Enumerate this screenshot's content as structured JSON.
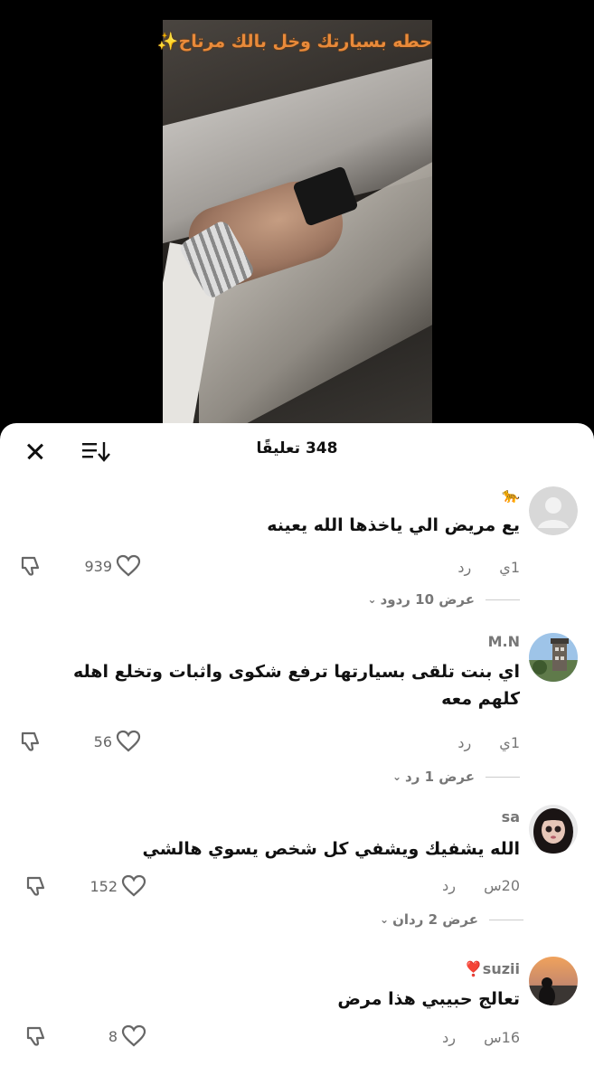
{
  "video": {
    "caption": "حطه بسيارتك وخل بالك مرتاح✨"
  },
  "sheet": {
    "title": "348 تعليقًا"
  },
  "comments": [
    {
      "username": "🐆",
      "text": "يع مريض الي ياخذها الله يعينه",
      "time": "1ي",
      "reply_label": "رد",
      "likes": "939",
      "view_replies": "عرض 10 ردود",
      "avatar": "default-avatar"
    },
    {
      "username": "M.N",
      "text": "اي بنت تلقى بسيارتها ترفع شكوى واثبات وتخلع اهله كلهم معه",
      "time": "1ي",
      "reply_label": "رد",
      "likes": "56",
      "view_replies": "عرض 1 رد",
      "avatar": "building-photo"
    },
    {
      "username": "sa",
      "text": "الله يشفيك ويشفي كل شخص يسوي هالشي",
      "time": "20س",
      "reply_label": "رد",
      "likes": "152",
      "view_replies": "عرض 2 ردان",
      "avatar": "doll-photo"
    },
    {
      "username": "suzii❣️",
      "text": "تعالج حبيبي هذا مرض",
      "time": "16س",
      "reply_label": "رد",
      "likes": "8",
      "view_replies": "",
      "avatar": "sunset-silhouette-photo"
    }
  ]
}
